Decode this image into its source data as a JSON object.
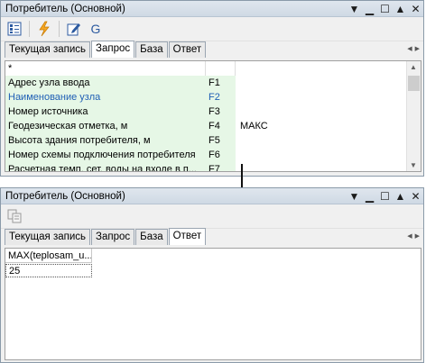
{
  "top_window": {
    "title": "Потребитель (Основной)",
    "toolbar": {
      "g_label": "G"
    },
    "tabs": [
      "Текущая запись",
      "Запрос",
      "База",
      "Ответ"
    ],
    "active_tab": "Запрос",
    "grid": {
      "header_mark": "*",
      "rows": [
        {
          "name": "Адрес узла ввода",
          "key": "F1",
          "value": "",
          "link": false
        },
        {
          "name": "Наименование узла",
          "key": "F2",
          "value": "",
          "link": true
        },
        {
          "name": "Номер источника",
          "key": "F3",
          "value": "",
          "link": false
        },
        {
          "name": "Геодезическая отметка, м",
          "key": "F4",
          "value": "МАКС",
          "link": false
        },
        {
          "name": "Высота здания потребителя, м",
          "key": "F5",
          "value": "",
          "link": false
        },
        {
          "name": "Номер схемы подключения потребителя",
          "key": "F6",
          "value": "",
          "link": false
        },
        {
          "name": "Расчетная темп. сет. воды на входе в п...",
          "key": "F7",
          "value": "",
          "link": false
        }
      ]
    }
  },
  "bottom_window": {
    "title": "Потребитель (Основной)",
    "tabs": [
      "Текущая запись",
      "Запрос",
      "База",
      "Ответ"
    ],
    "active_tab": "Ответ",
    "result": {
      "column_header": "MAX(teplosam_u...",
      "value": "25"
    }
  },
  "colors": {
    "link": "#1f5fb5",
    "highlight": "#e6f7e6",
    "titlebar": "#cfd9e4"
  }
}
